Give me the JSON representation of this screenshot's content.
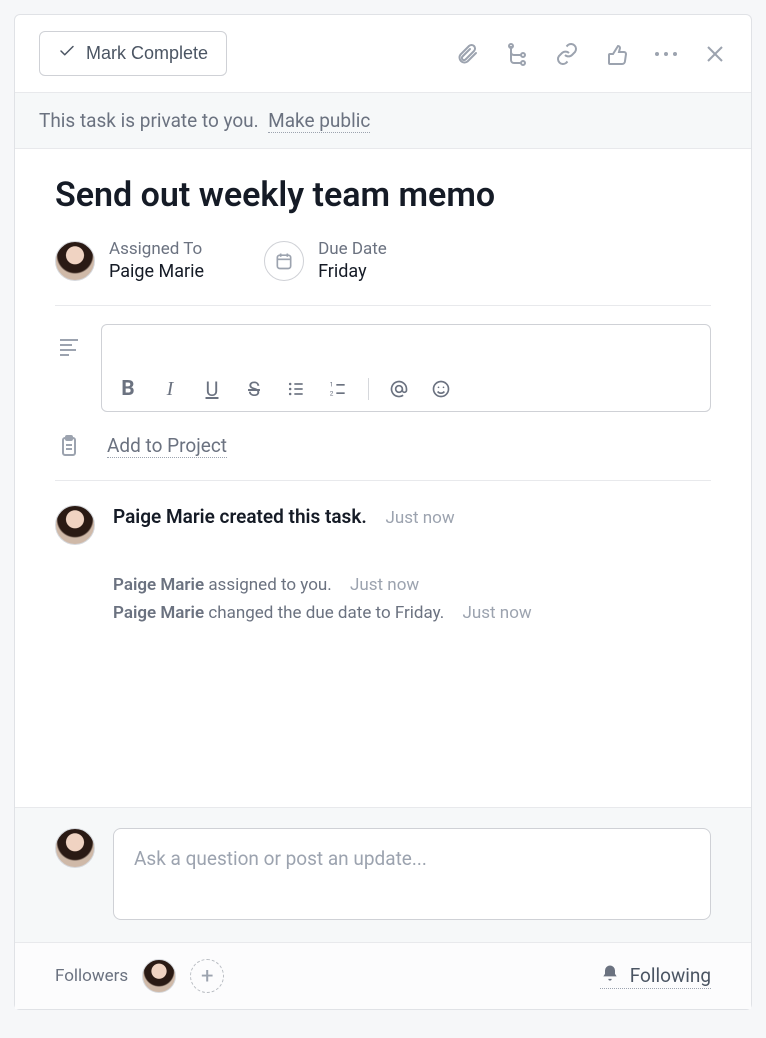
{
  "toolbar": {
    "mark_complete_label": "Mark Complete"
  },
  "banner": {
    "text": "This task is private to you.",
    "action": "Make public"
  },
  "task": {
    "title": "Send out weekly team memo",
    "assigned_to_label": "Assigned To",
    "assigned_to": "Paige Marie",
    "due_date_label": "Due Date",
    "due_date": "Friday"
  },
  "editor": {
    "bold": "B",
    "italic": "I",
    "underline": "U",
    "strike": "S"
  },
  "project": {
    "add_label": "Add to Project"
  },
  "activity": {
    "created": {
      "actor": "Paige Marie",
      "text": "created this task.",
      "time": "Just now"
    },
    "sub": [
      {
        "actor": "Paige Marie",
        "text": "assigned to you.",
        "time": "Just now"
      },
      {
        "actor": "Paige Marie",
        "text": "changed the due date to Friday.",
        "time": "Just now"
      }
    ]
  },
  "composer": {
    "placeholder": "Ask a question or post an update..."
  },
  "footer": {
    "followers_label": "Followers",
    "following_label": "Following"
  }
}
